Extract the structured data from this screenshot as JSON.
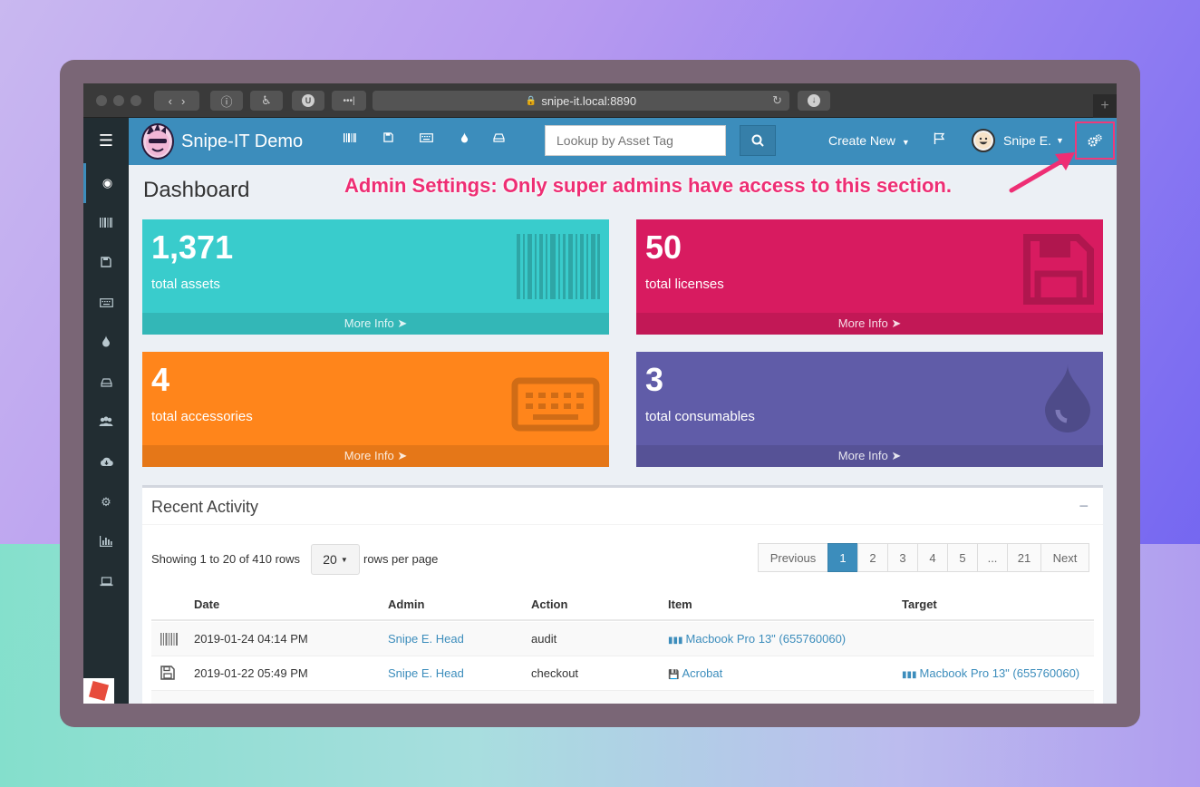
{
  "browser": {
    "url": "snipe-it.local:8890"
  },
  "header": {
    "brand": "Snipe-IT Demo",
    "lookup_placeholder": "Lookup by Asset Tag",
    "create_new": "Create New",
    "user": "Snipe E."
  },
  "annotation": "Admin Settings: Only super admins have access to this section.",
  "page_title": "Dashboard",
  "stats": [
    {
      "value": "1,371",
      "label": "total assets",
      "more": "More Info",
      "color": "#39cccc"
    },
    {
      "value": "50",
      "label": "total licenses",
      "more": "More Info",
      "color": "#d81b60"
    },
    {
      "value": "4",
      "label": "total accessories",
      "more": "More Info",
      "color": "#ff851b"
    },
    {
      "value": "3",
      "label": "total consumables",
      "more": "More Info",
      "color": "#605ca8"
    }
  ],
  "recent": {
    "title": "Recent Activity",
    "collapse": "−",
    "showing": "Showing 1 to 20 of 410 rows",
    "per_page": "20",
    "per_page_label": "rows per page",
    "pager": [
      "Previous",
      "1",
      "2",
      "3",
      "4",
      "5",
      "...",
      "21",
      "Next"
    ],
    "columns": [
      "Date",
      "Admin",
      "Action",
      "Item",
      "Target"
    ],
    "rows": [
      {
        "date": "2019-01-24 04:14 PM",
        "admin": "Snipe E. Head",
        "action": "audit",
        "item": "Macbook Pro 13\" (655760060)",
        "target": ""
      },
      {
        "date": "2019-01-22 05:49 PM",
        "admin": "Snipe E. Head",
        "action": "checkout",
        "item": "Acrobat",
        "target": "Macbook Pro 13\" (655760060)"
      }
    ]
  },
  "colors": {
    "topnav": "#3c8dbc",
    "sidebar": "#222d32",
    "annotation": "#ee2e74"
  }
}
